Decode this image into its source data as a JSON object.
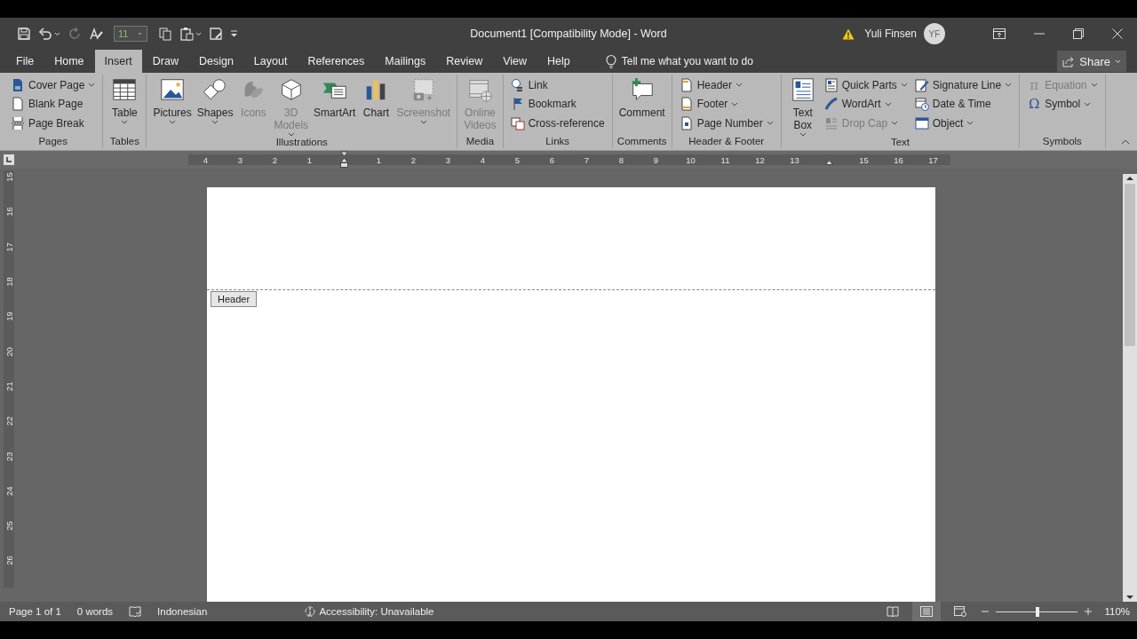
{
  "quick_access": {
    "font_size": "11"
  },
  "window": {
    "title": "Document1 [Compatibility Mode]  -  Word"
  },
  "account": {
    "name": "Yuli Finsen",
    "initials": "YF"
  },
  "tabs": [
    {
      "label": "File",
      "selected": false
    },
    {
      "label": "Home",
      "selected": false
    },
    {
      "label": "Insert",
      "selected": true
    },
    {
      "label": "Draw",
      "selected": false
    },
    {
      "label": "Design",
      "selected": false
    },
    {
      "label": "Layout",
      "selected": false
    },
    {
      "label": "References",
      "selected": false
    },
    {
      "label": "Mailings",
      "selected": false
    },
    {
      "label": "Review",
      "selected": false
    },
    {
      "label": "View",
      "selected": false
    },
    {
      "label": "Help",
      "selected": false
    }
  ],
  "tell_me": {
    "placeholder": "Tell me what you want to do"
  },
  "share": {
    "label": "Share"
  },
  "ribbon_groups": [
    {
      "name": "Pages",
      "items": [
        {
          "kind": "small",
          "label": "Cover Page",
          "menu": true,
          "disabled": false
        },
        {
          "kind": "small",
          "label": "Blank Page",
          "menu": false,
          "disabled": false
        },
        {
          "kind": "small",
          "label": "Page Break",
          "menu": false,
          "disabled": false
        }
      ]
    },
    {
      "name": "Tables",
      "items": [
        {
          "kind": "large",
          "label": "Table",
          "menu": true,
          "disabled": false
        }
      ]
    },
    {
      "name": "Illustrations",
      "items": [
        {
          "kind": "large",
          "label": "Pictures",
          "menu": true,
          "disabled": false
        },
        {
          "kind": "large",
          "label": "Shapes",
          "menu": true,
          "disabled": false
        },
        {
          "kind": "large",
          "label": "Icons",
          "menu": false,
          "disabled": true
        },
        {
          "kind": "large",
          "label": "3D Models",
          "menu": true,
          "disabled": true
        },
        {
          "kind": "large",
          "label": "SmartArt",
          "menu": false,
          "disabled": false
        },
        {
          "kind": "large",
          "label": "Chart",
          "menu": false,
          "disabled": false
        },
        {
          "kind": "large",
          "label": "Screenshot",
          "menu": true,
          "disabled": true
        }
      ]
    },
    {
      "name": "Media",
      "items": [
        {
          "kind": "large",
          "label": "Online Videos",
          "menu": false,
          "disabled": true
        }
      ]
    },
    {
      "name": "Links",
      "items": [
        {
          "kind": "small",
          "label": "Link",
          "menu": false,
          "disabled": false
        },
        {
          "kind": "small",
          "label": "Bookmark",
          "menu": false,
          "disabled": false
        },
        {
          "kind": "small",
          "label": "Cross-reference",
          "menu": false,
          "disabled": false
        }
      ]
    },
    {
      "name": "Comments",
      "items": [
        {
          "kind": "large",
          "label": "Comment",
          "menu": false,
          "disabled": false
        }
      ]
    },
    {
      "name": "Header & Footer",
      "items": [
        {
          "kind": "small",
          "label": "Header",
          "menu": true,
          "disabled": false
        },
        {
          "kind": "small",
          "label": "Footer",
          "menu": true,
          "disabled": false
        },
        {
          "kind": "small",
          "label": "Page Number",
          "menu": true,
          "disabled": false
        }
      ]
    },
    {
      "name": "Text",
      "items": [
        {
          "kind": "large",
          "label": "Text Box",
          "menu": true,
          "disabled": false
        },
        {
          "kind": "small",
          "label": "Quick Parts",
          "menu": true,
          "disabled": false
        },
        {
          "kind": "small",
          "label": "WordArt",
          "menu": true,
          "disabled": false
        },
        {
          "kind": "small",
          "label": "Drop Cap",
          "menu": true,
          "disabled": true
        },
        {
          "kind": "small",
          "label": "Signature Line",
          "menu": true,
          "disabled": false
        },
        {
          "kind": "small",
          "label": "Date & Time",
          "menu": false,
          "disabled": false
        },
        {
          "kind": "small",
          "label": "Object",
          "menu": true,
          "disabled": false
        }
      ]
    },
    {
      "name": "Symbols",
      "items": [
        {
          "kind": "small",
          "label": "Equation",
          "glyph": "π",
          "menu": true,
          "disabled": true
        },
        {
          "kind": "small",
          "label": "Symbol",
          "glyph": "Ω",
          "menu": true,
          "disabled": false
        }
      ]
    }
  ],
  "horizontal_ruler": [
    {
      "kind": "number",
      "label": "4"
    },
    {
      "kind": "number",
      "label": "3"
    },
    {
      "kind": "number",
      "label": "2"
    },
    {
      "kind": "number",
      "label": "1"
    },
    {
      "kind": "left_indent"
    },
    {
      "kind": "number",
      "label": "1"
    },
    {
      "kind": "number",
      "label": "2"
    },
    {
      "kind": "number",
      "label": "3"
    },
    {
      "kind": "number",
      "label": "4"
    },
    {
      "kind": "number",
      "label": "5"
    },
    {
      "kind": "number",
      "label": "6"
    },
    {
      "kind": "number",
      "label": "7"
    },
    {
      "kind": "number",
      "label": "8"
    },
    {
      "kind": "number",
      "label": "9"
    },
    {
      "kind": "number",
      "label": "10"
    },
    {
      "kind": "number",
      "label": "11"
    },
    {
      "kind": "number",
      "label": "12"
    },
    {
      "kind": "number",
      "label": "13"
    },
    {
      "kind": "right_indent"
    },
    {
      "kind": "number",
      "label": "15"
    },
    {
      "kind": "number",
      "label": "16"
    },
    {
      "kind": "number",
      "label": "17"
    }
  ],
  "vertical_ruler": [
    "15",
    "16",
    "17",
    "18",
    "19",
    "20",
    "21",
    "22",
    "23",
    "24",
    "25",
    "26"
  ],
  "document": {
    "header_tag": "Header"
  },
  "status_bar": {
    "page": "Page 1 of 1",
    "words": "0 words",
    "language": "Indonesian",
    "accessibility": "Accessibility: Unavailable",
    "views": [
      {
        "kind": "read",
        "selected": false
      },
      {
        "kind": "print",
        "selected": true
      },
      {
        "kind": "web",
        "selected": false
      }
    ],
    "zoom": {
      "level": 0.51,
      "reading": "110%"
    }
  }
}
